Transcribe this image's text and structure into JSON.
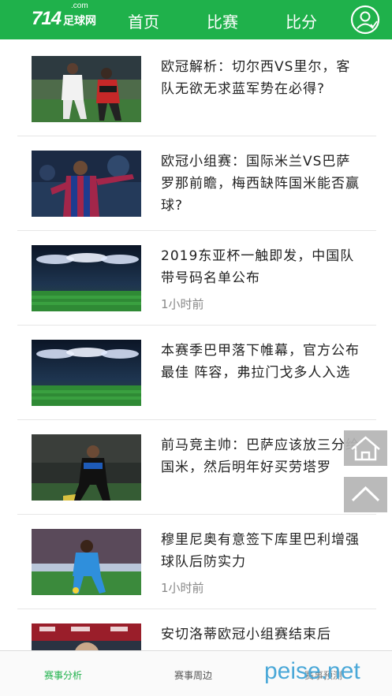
{
  "header": {
    "logo_number": "714",
    "logo_text": "足球网",
    "logo_domain": ".com",
    "nav": [
      "首页",
      "比赛",
      "比分"
    ],
    "user_icon": "user-icon",
    "brand_color": "#1fb14b"
  },
  "articles": [
    {
      "title": "欧冠解析：切尔西VS里尔，客队无欲无求蓝军势在必得?",
      "time": ""
    },
    {
      "title": "欧冠小组赛：国际米兰VS巴萨罗那前瞻，梅西缺阵国米能否赢球?",
      "time": ""
    },
    {
      "title": "2019东亚杯一触即发，中国队带号码名单公布",
      "time": "1小时前"
    },
    {
      "title": "本赛季巴甲落下帷幕，官方公布最佳 阵容，弗拉门戈多人入选",
      "time": ""
    },
    {
      "title": "前马竞主帅：巴萨应该放三分给国米，然后明年好买劳塔罗",
      "time": ""
    },
    {
      "title": "穆里尼奥有意签下库里巴利增强球队后防实力",
      "time": "1小时前"
    },
    {
      "title": "安切洛蒂欧冠小组赛结束后",
      "time": ""
    }
  ],
  "float_buttons": {
    "home_icon": "home-icon",
    "top_icon": "chevron-up-icon"
  },
  "tabs": [
    {
      "label": "赛事分析",
      "active": true
    },
    {
      "label": "赛事周边",
      "active": false
    },
    {
      "label": "赛事预测",
      "active": false
    }
  ],
  "watermark": "peise.net"
}
